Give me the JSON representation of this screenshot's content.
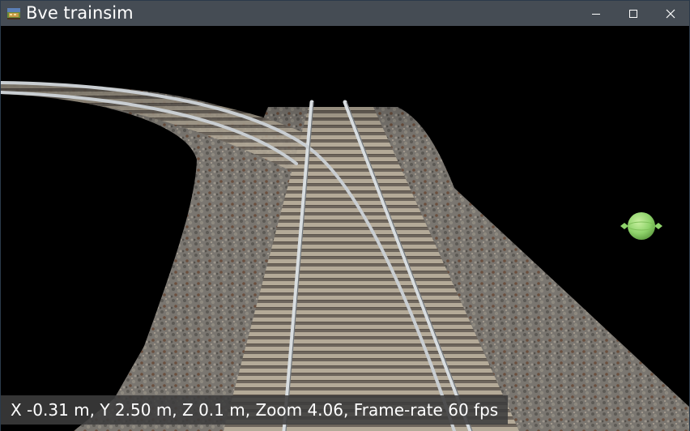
{
  "window": {
    "title": "Bve trainsim",
    "title_bar_color": "#454c54",
    "icon": "train-landscape-icon"
  },
  "controls": {
    "minimize_icon": "minimize-icon",
    "maximize_icon": "maximize-icon",
    "close_icon": "close-icon"
  },
  "viewport": {
    "background": "#000000",
    "scene": "ballast track with turnout diverging left",
    "status_text": "X -0.31 m, Y 2.50 m, Z 0.1 m, Zoom 4.06, Frame-rate 60 fps",
    "light_gizmo_icon": "light-source-icon",
    "light_gizmo_color": "#8fd36b"
  }
}
